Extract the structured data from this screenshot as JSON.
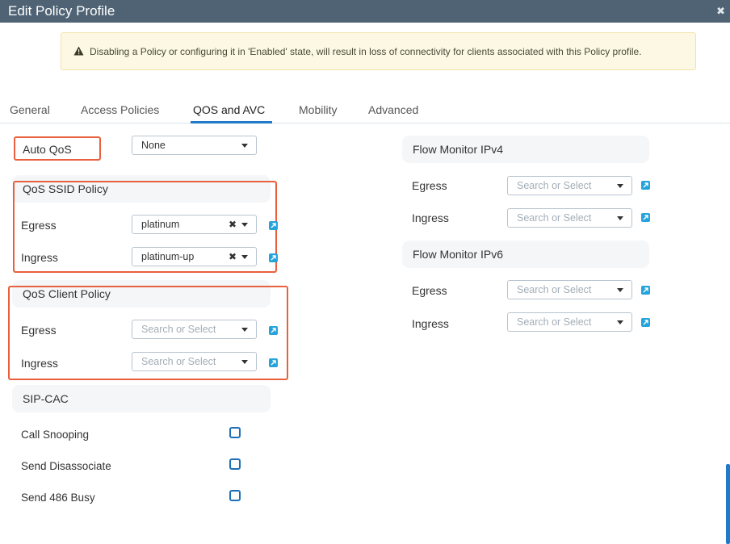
{
  "window": {
    "title": "Edit Policy Profile",
    "close_icon": "close-icon"
  },
  "alert": {
    "icon": "warning-icon",
    "text": "Disabling a Policy or configuring it in 'Enabled' state, will result in loss of connectivity for clients associated with this Policy profile."
  },
  "tabs": [
    {
      "label": "General"
    },
    {
      "label": "Access Policies"
    },
    {
      "label": "QOS and AVC",
      "active": true
    },
    {
      "label": "Mobility"
    },
    {
      "label": "Advanced"
    }
  ],
  "auto_qos": {
    "label": "Auto QoS",
    "value": "None"
  },
  "qos_ssid": {
    "title": "QoS SSID Policy",
    "egress": {
      "label": "Egress",
      "value": "platinum"
    },
    "ingress": {
      "label": "Ingress",
      "value": "platinum-up"
    }
  },
  "qos_client": {
    "title": "QoS Client Policy",
    "egress": {
      "label": "Egress",
      "placeholder": "Search or Select"
    },
    "ingress": {
      "label": "Ingress",
      "placeholder": "Search or Select"
    }
  },
  "sip_cac": {
    "title": "SIP-CAC",
    "items": [
      {
        "label": "Call Snooping",
        "checked": false
      },
      {
        "label": "Send Disassociate",
        "checked": false
      },
      {
        "label": "Send 486 Busy",
        "checked": false
      }
    ]
  },
  "flow_ipv4": {
    "title": "Flow Monitor IPv4",
    "egress": {
      "label": "Egress",
      "placeholder": "Search or Select"
    },
    "ingress": {
      "label": "Ingress",
      "placeholder": "Search or Select"
    }
  },
  "flow_ipv6": {
    "title": "Flow Monitor IPv6",
    "egress": {
      "label": "Egress",
      "placeholder": "Search or Select"
    },
    "ingress": {
      "label": "Ingress",
      "placeholder": "Search or Select"
    }
  },
  "colors": {
    "header": "#4f6374",
    "accent": "#1f7ac8",
    "highlight": "#e8603c",
    "alert_bg": "#fcf8e3",
    "link_icon": "#25a3dc"
  }
}
